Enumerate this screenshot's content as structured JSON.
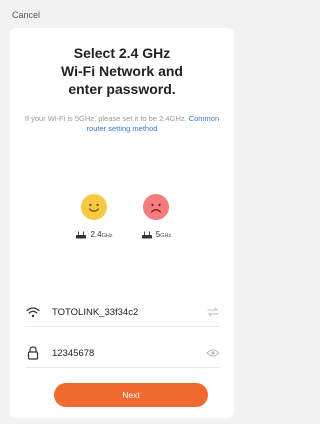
{
  "header": {
    "cancel_label": "Cancel"
  },
  "title": {
    "line1": "Select 2.4 GHz",
    "line2": "Wi-Fi Network and",
    "line3": "enter password."
  },
  "hint": {
    "text": "If your Wi-Fi is 5GHz, please set it to be 2.4GHz.",
    "link": "Common router setting method"
  },
  "bands": [
    {
      "label": "2.4",
      "unit": "GHz",
      "face": "happy-face-icon"
    },
    {
      "label": "5",
      "unit": "GHz",
      "face": "sad-face-icon"
    }
  ],
  "wifi": {
    "ssid": "TOTOLINK_33f34c2",
    "password": "12345678"
  },
  "actions": {
    "next_label": "Next"
  },
  "colors": {
    "accent": "#f06a2f",
    "link": "#3a78c9",
    "happy": "#f7c942",
    "sad": "#f47c7c"
  }
}
